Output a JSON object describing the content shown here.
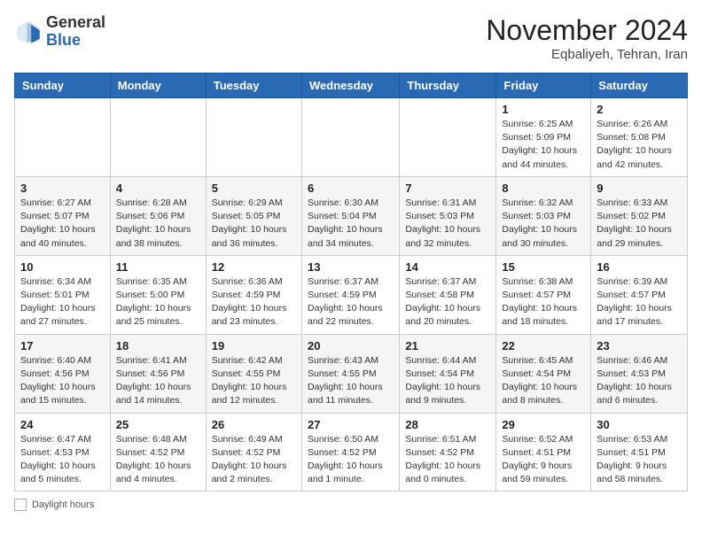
{
  "header": {
    "logo_general": "General",
    "logo_blue": "Blue",
    "month_title": "November 2024",
    "location": "Eqbaliyeh, Tehran, Iran"
  },
  "weekdays": [
    "Sunday",
    "Monday",
    "Tuesday",
    "Wednesday",
    "Thursday",
    "Friday",
    "Saturday"
  ],
  "weeks": [
    [
      {
        "day": "",
        "detail": ""
      },
      {
        "day": "",
        "detail": ""
      },
      {
        "day": "",
        "detail": ""
      },
      {
        "day": "",
        "detail": ""
      },
      {
        "day": "",
        "detail": ""
      },
      {
        "day": "1",
        "detail": "Sunrise: 6:25 AM\nSunset: 5:09 PM\nDaylight: 10 hours and 44 minutes."
      },
      {
        "day": "2",
        "detail": "Sunrise: 6:26 AM\nSunset: 5:08 PM\nDaylight: 10 hours and 42 minutes."
      }
    ],
    [
      {
        "day": "3",
        "detail": "Sunrise: 6:27 AM\nSunset: 5:07 PM\nDaylight: 10 hours and 40 minutes."
      },
      {
        "day": "4",
        "detail": "Sunrise: 6:28 AM\nSunset: 5:06 PM\nDaylight: 10 hours and 38 minutes."
      },
      {
        "day": "5",
        "detail": "Sunrise: 6:29 AM\nSunset: 5:05 PM\nDaylight: 10 hours and 36 minutes."
      },
      {
        "day": "6",
        "detail": "Sunrise: 6:30 AM\nSunset: 5:04 PM\nDaylight: 10 hours and 34 minutes."
      },
      {
        "day": "7",
        "detail": "Sunrise: 6:31 AM\nSunset: 5:03 PM\nDaylight: 10 hours and 32 minutes."
      },
      {
        "day": "8",
        "detail": "Sunrise: 6:32 AM\nSunset: 5:03 PM\nDaylight: 10 hours and 30 minutes."
      },
      {
        "day": "9",
        "detail": "Sunrise: 6:33 AM\nSunset: 5:02 PM\nDaylight: 10 hours and 29 minutes."
      }
    ],
    [
      {
        "day": "10",
        "detail": "Sunrise: 6:34 AM\nSunset: 5:01 PM\nDaylight: 10 hours and 27 minutes."
      },
      {
        "day": "11",
        "detail": "Sunrise: 6:35 AM\nSunset: 5:00 PM\nDaylight: 10 hours and 25 minutes."
      },
      {
        "day": "12",
        "detail": "Sunrise: 6:36 AM\nSunset: 4:59 PM\nDaylight: 10 hours and 23 minutes."
      },
      {
        "day": "13",
        "detail": "Sunrise: 6:37 AM\nSunset: 4:59 PM\nDaylight: 10 hours and 22 minutes."
      },
      {
        "day": "14",
        "detail": "Sunrise: 6:37 AM\nSunset: 4:58 PM\nDaylight: 10 hours and 20 minutes."
      },
      {
        "day": "15",
        "detail": "Sunrise: 6:38 AM\nSunset: 4:57 PM\nDaylight: 10 hours and 18 minutes."
      },
      {
        "day": "16",
        "detail": "Sunrise: 6:39 AM\nSunset: 4:57 PM\nDaylight: 10 hours and 17 minutes."
      }
    ],
    [
      {
        "day": "17",
        "detail": "Sunrise: 6:40 AM\nSunset: 4:56 PM\nDaylight: 10 hours and 15 minutes."
      },
      {
        "day": "18",
        "detail": "Sunrise: 6:41 AM\nSunset: 4:56 PM\nDaylight: 10 hours and 14 minutes."
      },
      {
        "day": "19",
        "detail": "Sunrise: 6:42 AM\nSunset: 4:55 PM\nDaylight: 10 hours and 12 minutes."
      },
      {
        "day": "20",
        "detail": "Sunrise: 6:43 AM\nSunset: 4:55 PM\nDaylight: 10 hours and 11 minutes."
      },
      {
        "day": "21",
        "detail": "Sunrise: 6:44 AM\nSunset: 4:54 PM\nDaylight: 10 hours and 9 minutes."
      },
      {
        "day": "22",
        "detail": "Sunrise: 6:45 AM\nSunset: 4:54 PM\nDaylight: 10 hours and 8 minutes."
      },
      {
        "day": "23",
        "detail": "Sunrise: 6:46 AM\nSunset: 4:53 PM\nDaylight: 10 hours and 6 minutes."
      }
    ],
    [
      {
        "day": "24",
        "detail": "Sunrise: 6:47 AM\nSunset: 4:53 PM\nDaylight: 10 hours and 5 minutes."
      },
      {
        "day": "25",
        "detail": "Sunrise: 6:48 AM\nSunset: 4:52 PM\nDaylight: 10 hours and 4 minutes."
      },
      {
        "day": "26",
        "detail": "Sunrise: 6:49 AM\nSunset: 4:52 PM\nDaylight: 10 hours and 2 minutes."
      },
      {
        "day": "27",
        "detail": "Sunrise: 6:50 AM\nSunset: 4:52 PM\nDaylight: 10 hours and 1 minute."
      },
      {
        "day": "28",
        "detail": "Sunrise: 6:51 AM\nSunset: 4:52 PM\nDaylight: 10 hours and 0 minutes."
      },
      {
        "day": "29",
        "detail": "Sunrise: 6:52 AM\nSunset: 4:51 PM\nDaylight: 9 hours and 59 minutes."
      },
      {
        "day": "30",
        "detail": "Sunrise: 6:53 AM\nSunset: 4:51 PM\nDaylight: 9 hours and 58 minutes."
      }
    ]
  ],
  "footer": {
    "legend_label": "Daylight hours"
  }
}
